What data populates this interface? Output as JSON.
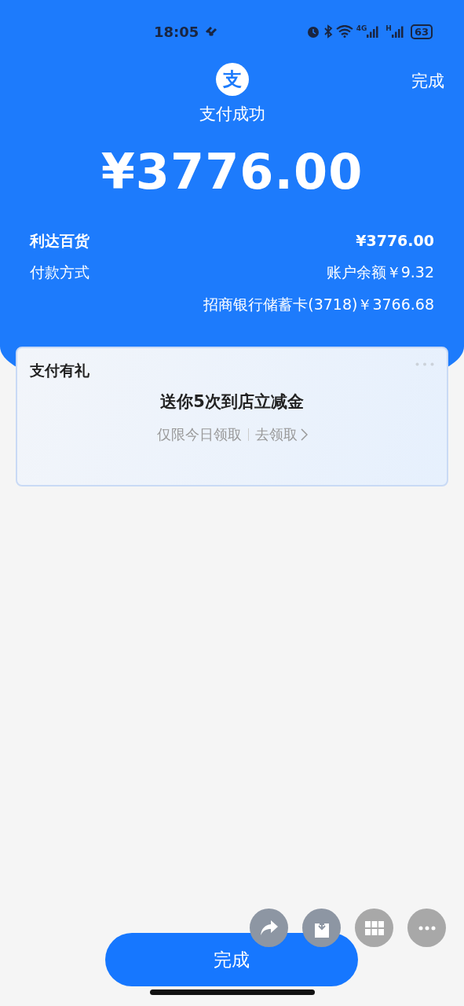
{
  "status_bar": {
    "time": "18:05",
    "network_1": "4G",
    "network_2": "H",
    "battery": "63"
  },
  "header": {
    "done_link": "完成",
    "logo_char": "支",
    "title": "支付成功",
    "amount": "¥3776.00"
  },
  "details": [
    {
      "label": "利达百货",
      "values": [
        "¥3776.00"
      ],
      "bold": true
    },
    {
      "label": "付款方式",
      "values": [
        "账户余额￥9.32",
        "招商银行储蓄卡(3718)￥3766.68"
      ],
      "bold": false
    }
  ],
  "promo": {
    "title": "支付有礼",
    "headline": "送你5次到店立减金",
    "note": "仅限今日领取",
    "link": "去领取"
  },
  "floating_actions": [
    {
      "kind": "share"
    },
    {
      "kind": "save"
    },
    {
      "kind": "grid"
    },
    {
      "kind": "more"
    }
  ],
  "done_button": "完成"
}
